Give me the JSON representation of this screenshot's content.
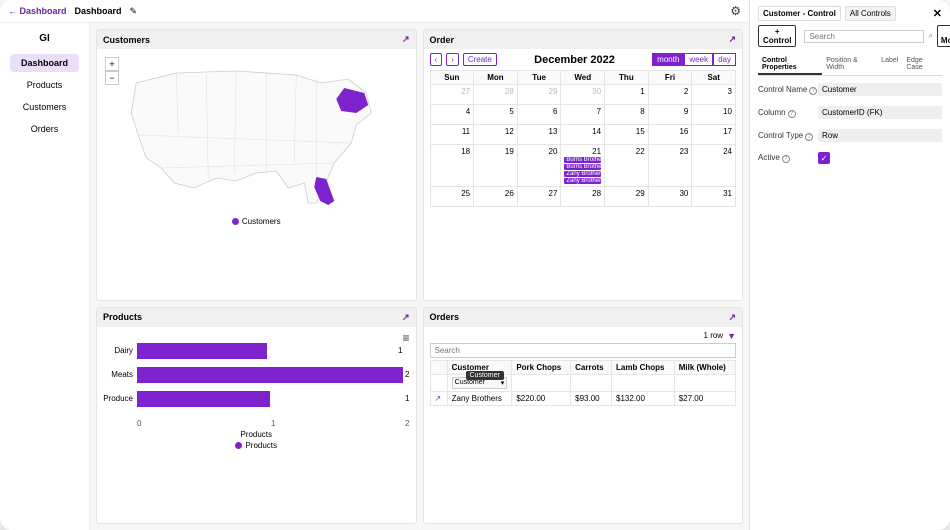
{
  "topbar": {
    "back": "← Dashboard",
    "crumb": "Dashboard",
    "edit_icon": "✎"
  },
  "tenant": "GI",
  "sidebar": {
    "items": [
      {
        "label": "Dashboard",
        "active": true
      },
      {
        "label": "Products"
      },
      {
        "label": "Customers"
      },
      {
        "label": "Orders"
      }
    ]
  },
  "customers_card": {
    "title": "Customers",
    "legend": "Customers",
    "zoom_in": "+",
    "zoom_out": "−"
  },
  "order_card": {
    "title": "Order",
    "prev": "‹",
    "next": "›",
    "create": "Create",
    "month": "December 2022",
    "view": {
      "month": "month",
      "week": "week",
      "day": "day"
    },
    "dow": [
      "Sun",
      "Mon",
      "Tue",
      "Wed",
      "Thu",
      "Fri",
      "Sat"
    ],
    "weeks": [
      [
        {
          "d": "27",
          "dim": true
        },
        {
          "d": "28",
          "dim": true
        },
        {
          "d": "29",
          "dim": true
        },
        {
          "d": "30",
          "dim": true
        },
        {
          "d": "1"
        },
        {
          "d": "2"
        },
        {
          "d": "3"
        }
      ],
      [
        {
          "d": "4"
        },
        {
          "d": "5"
        },
        {
          "d": "6"
        },
        {
          "d": "7"
        },
        {
          "d": "8"
        },
        {
          "d": "9"
        },
        {
          "d": "10"
        }
      ],
      [
        {
          "d": "11"
        },
        {
          "d": "12"
        },
        {
          "d": "13"
        },
        {
          "d": "14"
        },
        {
          "d": "15"
        },
        {
          "d": "16"
        },
        {
          "d": "17"
        }
      ],
      [
        {
          "d": "18"
        },
        {
          "d": "19"
        },
        {
          "d": "20"
        },
        {
          "d": "21",
          "events": [
            "Burris Brothers",
            "Burris Brothers",
            "Zany Brothers",
            "Zany Brothers"
          ]
        },
        {
          "d": "22"
        },
        {
          "d": "23"
        },
        {
          "d": "24"
        }
      ],
      [
        {
          "d": "25"
        },
        {
          "d": "26"
        },
        {
          "d": "27"
        },
        {
          "d": "28"
        },
        {
          "d": "29"
        },
        {
          "d": "30"
        },
        {
          "d": "31"
        }
      ]
    ]
  },
  "products_card": {
    "title": "Products",
    "xlabel": "Products",
    "legend": "Products",
    "ticks": [
      "0",
      "1",
      "2"
    ]
  },
  "orders_card": {
    "title": "Orders",
    "rowcount": "1 row",
    "search_ph": "Search",
    "popover": "Customer",
    "headers": [
      "",
      "Customer",
      "Pork Chops",
      "Carrots",
      "Lamb Chops",
      "Milk (Whole)"
    ],
    "customer_filter": "Customer",
    "row": {
      "customer": "Zany Brothers",
      "pork": "$220.00",
      "carrots": "$93.00",
      "lamb": "$132.00",
      "milk": "$27.00"
    }
  },
  "panel": {
    "tab_main": "Customer - Control",
    "tab_all": "All Controls",
    "add": "+ Control",
    "search_ph": "Search",
    "more": "⋮ More",
    "subtabs": [
      "Control Properties",
      "Position & Width",
      "Label",
      "Edge Case"
    ],
    "fields": {
      "name_label": "Control Name",
      "name_value": "Customer",
      "column_label": "Column",
      "column_value": "CustomerID (FK)",
      "type_label": "Control Type",
      "type_value": "Row",
      "active_label": "Active",
      "active_value": "✓"
    }
  },
  "chart_data": {
    "type": "bar",
    "orientation": "horizontal",
    "categories": [
      "Dairy",
      "Meats",
      "Produce"
    ],
    "values": [
      1,
      2,
      1
    ],
    "title": "",
    "xlabel": "Products",
    "ylabel": "",
    "xlim": [
      0,
      2
    ],
    "legend": [
      "Products"
    ]
  }
}
